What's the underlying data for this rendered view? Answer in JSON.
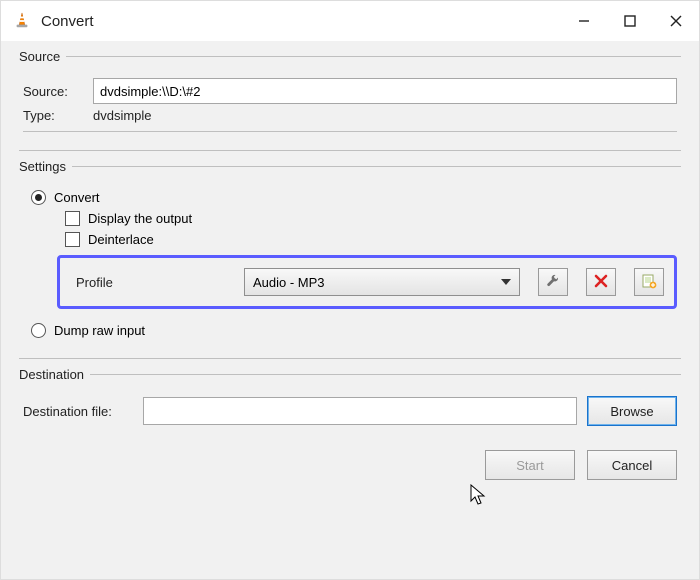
{
  "window": {
    "title": "Convert"
  },
  "source": {
    "legend": "Source",
    "source_label": "Source:",
    "source_value": "dvdsimple:\\\\D:\\#2",
    "type_label": "Type:",
    "type_value": "dvdsimple"
  },
  "settings": {
    "legend": "Settings",
    "convert_label": "Convert",
    "display_output_label": "Display the output",
    "deinterlace_label": "Deinterlace",
    "profile_label": "Profile",
    "profile_selected": "Audio - MP3",
    "dump_raw_label": "Dump raw input"
  },
  "destination": {
    "legend": "Destination",
    "file_label": "Destination file:",
    "file_value": "",
    "browse_label": "Browse"
  },
  "actions": {
    "start_label": "Start",
    "cancel_label": "Cancel"
  }
}
